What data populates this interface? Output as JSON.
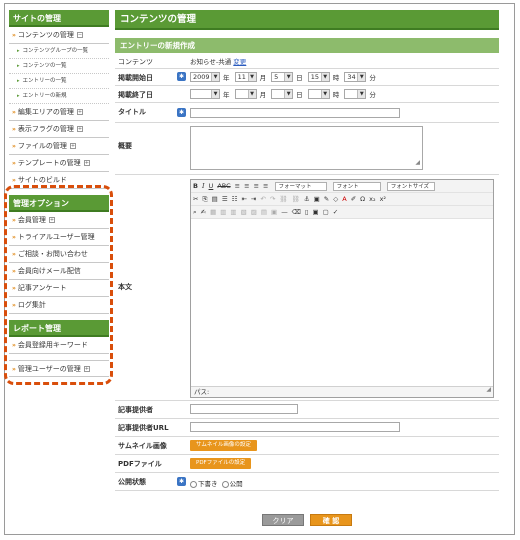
{
  "sidebar": {
    "site_title": "サイトの管理",
    "contents_mgmt": "コンテンツの管理",
    "sub_items": [
      "コンテンツグループの一覧",
      "コンテンツの一覧",
      "エントリーの一覧",
      "エントリーの新規"
    ],
    "items": [
      "編集エリアの管理",
      "表示フラグの管理",
      "ファイルの管理",
      "テンプレートの管理",
      "サイトのビルド"
    ],
    "options_title": "管理オプション",
    "options_items": [
      "会員管理",
      "トライアルユーザー管理",
      "ご相談・お問い合わせ",
      "会員向けメール配信",
      "記事アンケート",
      "ログ集計"
    ],
    "report_title": "レポート管理",
    "report_items": [
      "会員登録用キーワード"
    ],
    "admin_item": "管理ユーザーの管理"
  },
  "main": {
    "title": "コンテンツの管理",
    "section": "エントリーの新規作成",
    "labels": {
      "contents": "コンテンツ",
      "pub_start": "掲載開始日",
      "pub_end": "掲載終了日",
      "title": "タイトル",
      "summary": "概要",
      "body": "本文",
      "author": "記事提供者",
      "author_url": "記事提供者URL",
      "thumbnail": "サムネイル画像",
      "pdf": "PDFファイル",
      "status": "公開状態"
    },
    "contents_value": "お知らせ-共通",
    "contents_change": "変更",
    "date": {
      "year": "2009",
      "month": "11",
      "day": "5",
      "hour": "15",
      "minute": "34"
    },
    "units": {
      "year": "年",
      "month": "月",
      "day": "日",
      "hour": "時",
      "minute": "分"
    },
    "thumbnail_button": "サムネイル画像の設定",
    "pdf_button": "PDFファイルの設定",
    "status_options": [
      "下書き",
      "公開"
    ],
    "editor": {
      "format_placeholder": "フォーマット",
      "font_placeholder": "フォント",
      "font_size_placeholder": "フォントサイズ",
      "path_label": "パス:"
    },
    "buttons": {
      "clear": "クリア",
      "confirm": "確 認"
    }
  }
}
